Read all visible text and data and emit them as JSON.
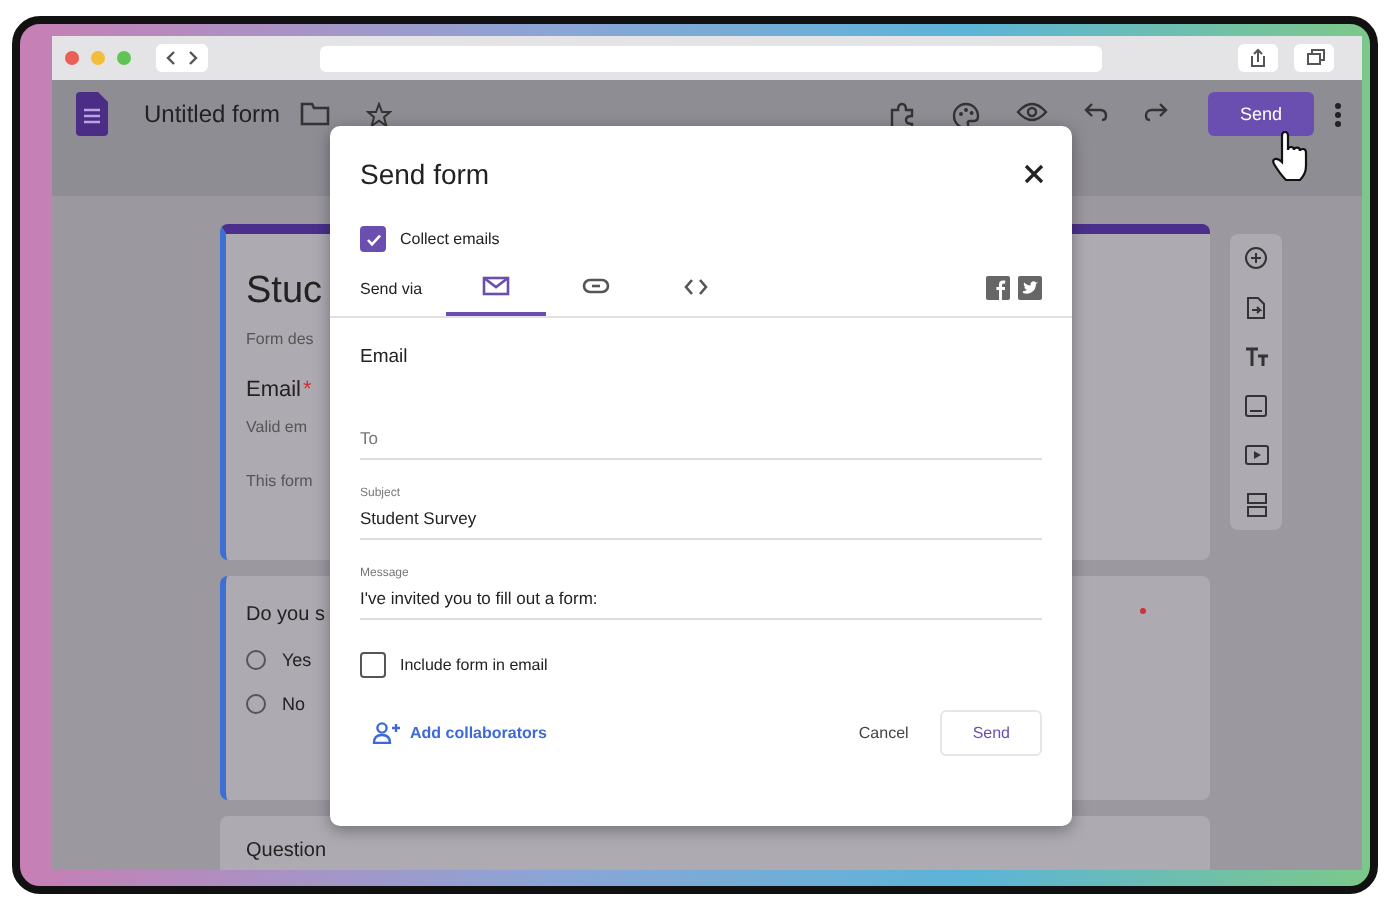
{
  "app_bar": {
    "title": "Untitled form",
    "send_button": "Send"
  },
  "form_preview": {
    "title": "Stuc",
    "description": "Form des",
    "question": {
      "label": "Email",
      "required_mark": "*",
      "hint": "Valid em"
    },
    "note": "This form",
    "question_2": {
      "text": "Do you s",
      "options": [
        {
          "label": "Yes",
          "selected": false
        },
        {
          "label": "No",
          "selected": false
        }
      ]
    },
    "question_3": "Question"
  },
  "dialog": {
    "title": "Send form",
    "collect_emails": {
      "label": "Collect emails",
      "checked": true
    },
    "send_via_label": "Send via",
    "tabs": [
      {
        "kind": "email",
        "selected": true
      },
      {
        "kind": "link",
        "selected": false
      },
      {
        "kind": "embed",
        "selected": false
      }
    ],
    "section_title": "Email",
    "fields": [
      {
        "placeholder": "To"
      },
      {
        "label": "Subject",
        "value": "Student Survey"
      },
      {
        "label": "Message",
        "value": "I've invited you to fill out a form:"
      }
    ],
    "include_form": {
      "label": "Include form in email",
      "checked": false
    },
    "add_collaborators": "Add collaborators",
    "cancel": "Cancel",
    "send": "Send"
  }
}
